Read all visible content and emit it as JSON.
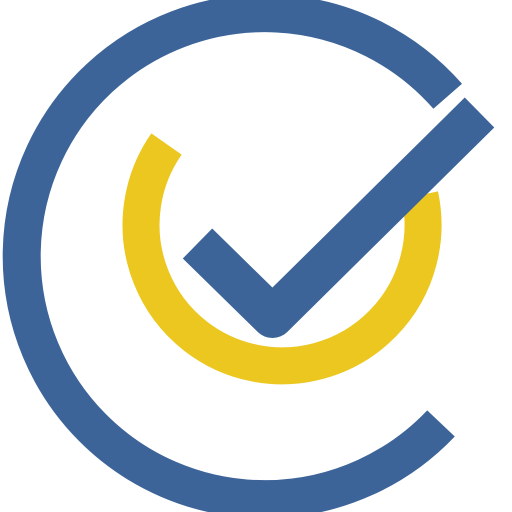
{
  "logo": {
    "icon": "check-circle-logo-icon",
    "colors": {
      "outer_ring": "#3C6499",
      "inner_ring": "#EBC71F",
      "checkmark": "#3C6499",
      "background": "#FFFFFF"
    }
  }
}
